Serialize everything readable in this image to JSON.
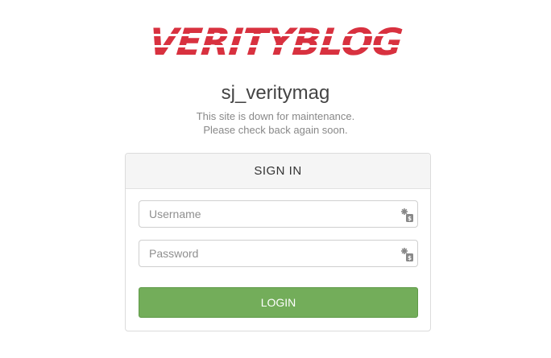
{
  "logo": {
    "text": "VERITYBLOG",
    "color": "#d8313f"
  },
  "site": {
    "name": "sj_veritymag",
    "message_line1": "This site is down for maintenance.",
    "message_line2": "Please check back again soon."
  },
  "login_panel": {
    "title": "SIGN IN",
    "username_placeholder": "Username",
    "password_placeholder": "Password",
    "password_manager_icon": "password-manager-icon",
    "login_label": "LOGIN",
    "login_color": "#73ad5a"
  }
}
